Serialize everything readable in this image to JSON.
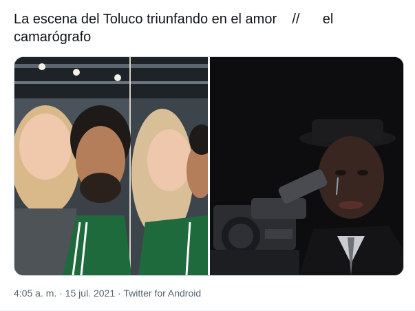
{
  "tweet": {
    "text": "La escena del Toluco triunfando en el amor    //      el camarógrafo"
  },
  "media": {
    "left_photo": "selfie-couple-stadium",
    "right_photo": "crying-cameraman"
  },
  "meta": {
    "time": "4:05 a. m.",
    "separator": " · ",
    "date": "15 jul. 2021",
    "source": "Twitter for Android"
  },
  "colors": {
    "text": "#0f1419",
    "meta": "#536471",
    "border": "#cfd9de"
  }
}
